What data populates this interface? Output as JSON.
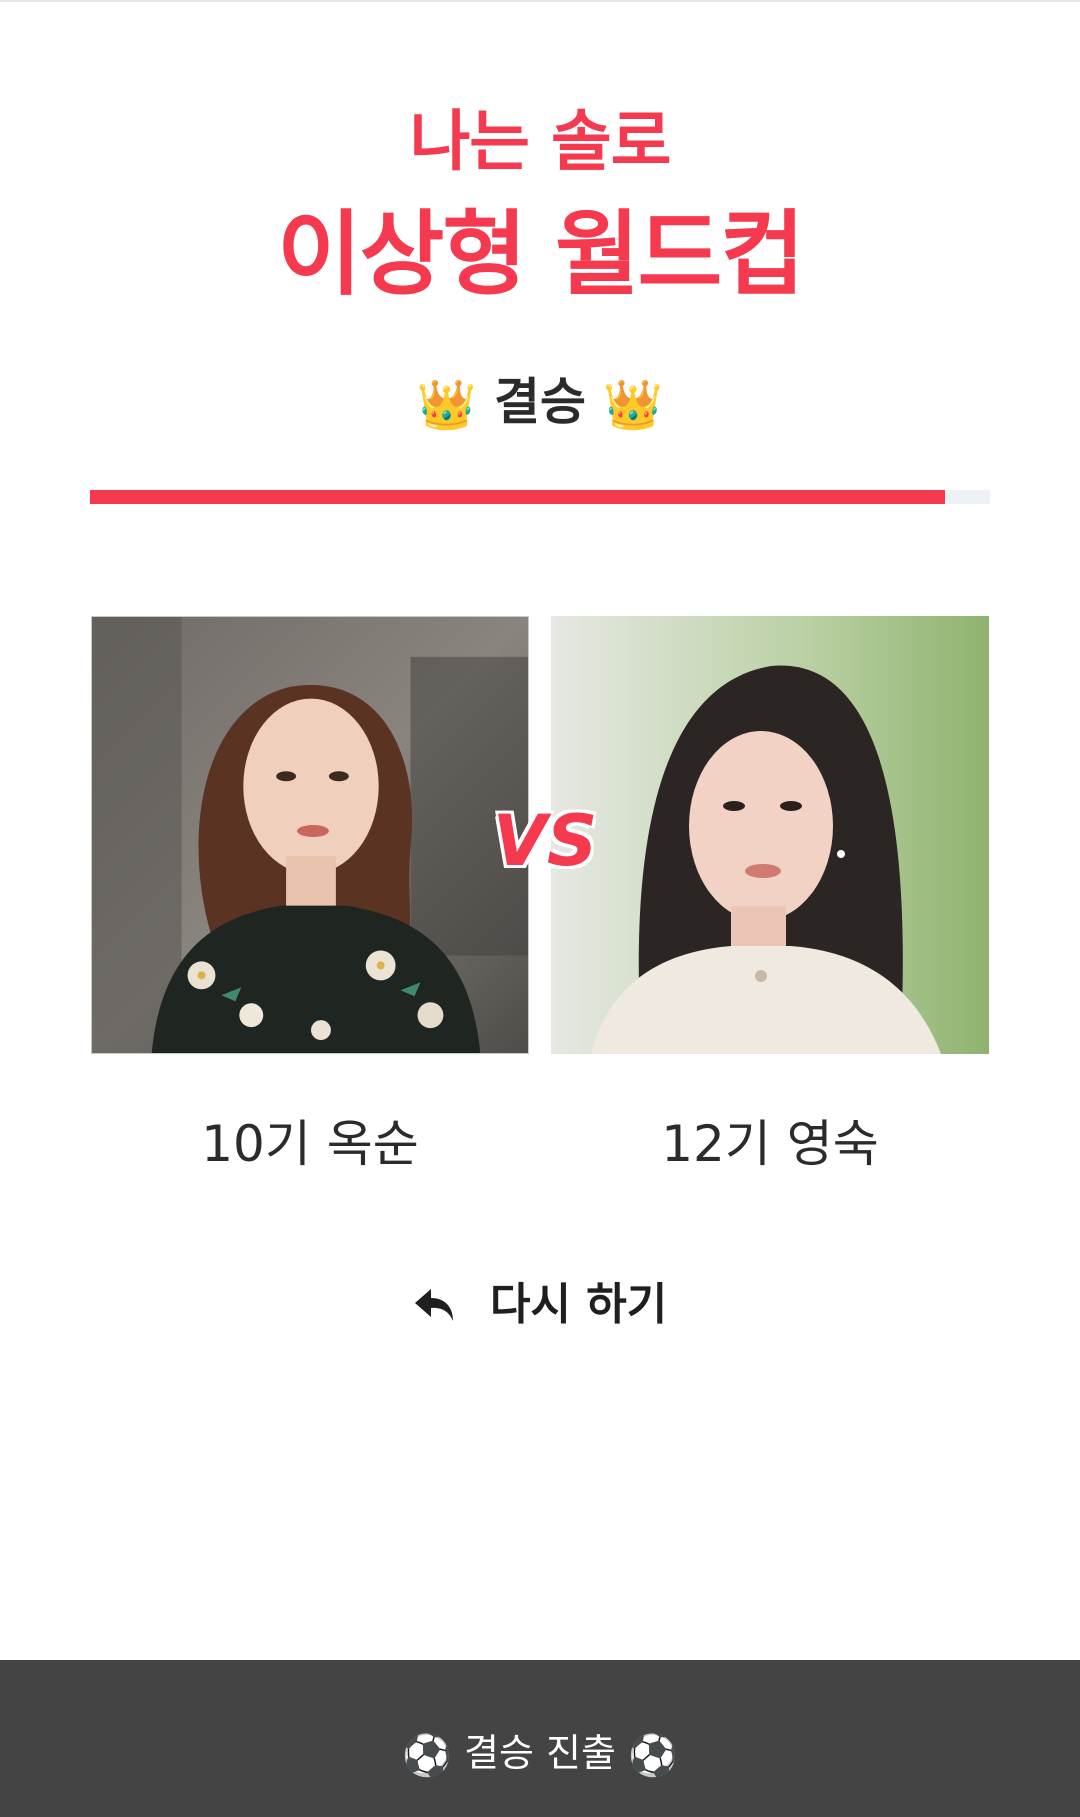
{
  "header": {
    "subtitle": "나는 솔로",
    "title": "이상형 월드컵"
  },
  "round": {
    "crown_icon": "👑",
    "label": "결승"
  },
  "progress": {
    "fraction": 0.95,
    "color": "#f5394f"
  },
  "match": {
    "vs_label": "VS",
    "left": {
      "name": "10기 옥순"
    },
    "right": {
      "name": "12기 영숙"
    }
  },
  "actions": {
    "retry_label": "다시 하기",
    "retry_icon": "undo-arrow-icon"
  },
  "footer": {
    "ball_icon": "⚽",
    "label": "결승 진출"
  },
  "colors": {
    "accent": "#f5394f",
    "footer_bg": "#444444"
  }
}
